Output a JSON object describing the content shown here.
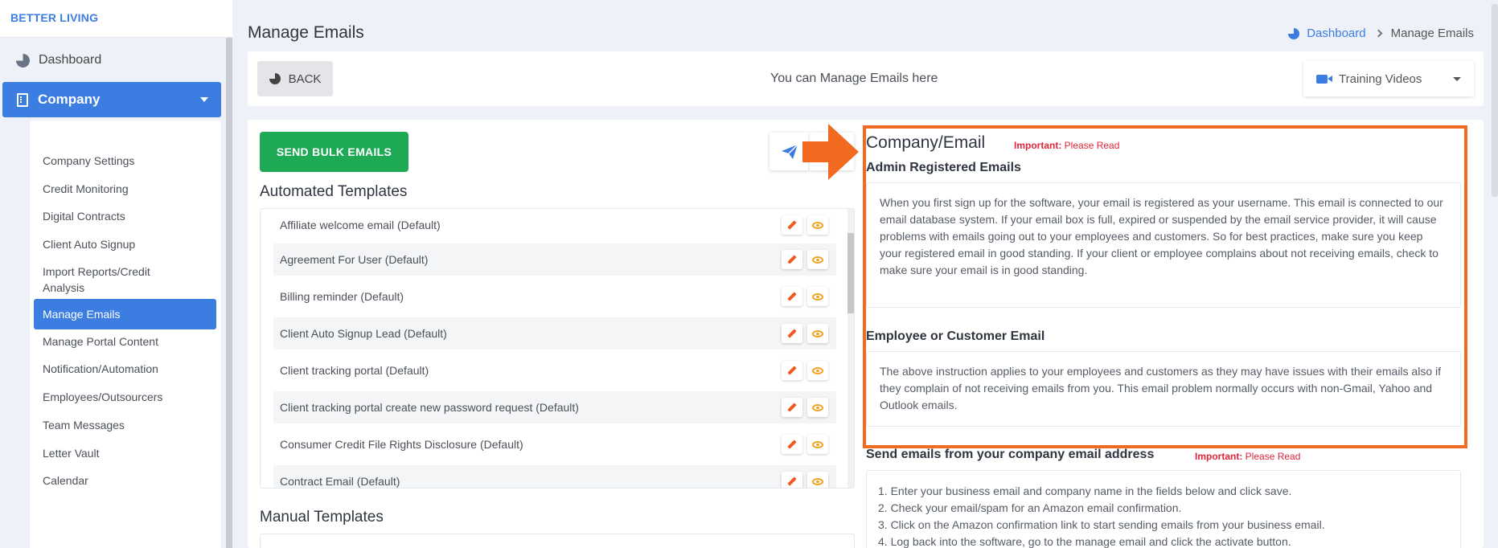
{
  "sidebar": {
    "brand": "BETTER LIVING",
    "dashboard": "Dashboard",
    "company": "Company",
    "items": [
      {
        "label": "Company Settings"
      },
      {
        "label": "Credit Monitoring"
      },
      {
        "label": "Digital Contracts"
      },
      {
        "label": "Client Auto Signup"
      },
      {
        "label": "Import Reports/Credit\nAnalysis"
      },
      {
        "label": "Manage Emails"
      },
      {
        "label": "Manage Portal Content"
      },
      {
        "label": "Notification/Automation"
      },
      {
        "label": "Employees/Outsourcers"
      },
      {
        "label": "Team Messages"
      },
      {
        "label": "Letter Vault"
      },
      {
        "label": "Calendar"
      }
    ]
  },
  "header": {
    "title": "Manage Emails",
    "breadcrumb": {
      "home": "Dashboard",
      "current": "Manage Emails"
    }
  },
  "topbar": {
    "back_label": "BACK",
    "message": "You can Manage Emails here",
    "training_label": "Training Videos"
  },
  "main": {
    "send_bulk_label": "SEND BULK EMAILS",
    "automated_heading": "Automated Templates",
    "manual_heading": "Manual Templates",
    "templates": [
      {
        "name": "Affiliate welcome email (Default)"
      },
      {
        "name": "Agreement For User (Default)"
      },
      {
        "name": "Billing reminder (Default)"
      },
      {
        "name": "Client Auto Signup Lead (Default)"
      },
      {
        "name": "Client tracking portal (Default)"
      },
      {
        "name": "Client tracking portal create new password request (Default)"
      },
      {
        "name": "Consumer Credit File Rights Disclosure (Default)"
      },
      {
        "name": "Contract Email (Default)"
      }
    ]
  },
  "info": {
    "title": "Company/Email",
    "important_label": "Important:",
    "important_text": "Please Read",
    "admin_heading": "Admin Registered Emails",
    "admin_text": "When you first sign up for the software, your email is registered as your username. This email is connected to our email database system. If your email box is full, expired or suspended by the email service provider, it will cause problems with emails going out to your employees and customers. So for best practices, make sure you keep your registered email in good standing. If your client or employee complains about not receiving emails, check to make sure your email is in good standing.",
    "employee_heading": "Employee or Customer Email",
    "employee_text": "The above instruction applies to your employees and customers as they may have issues with their emails also if they complain of not receiving emails from you. This email problem normally occurs with non-Gmail, Yahoo and Outlook emails.",
    "send_heading": "Send emails from your company email address",
    "steps": [
      "1. Enter your business email and company name in the fields below and click save.",
      "2. Check your email/spam for an Amazon email confirmation.",
      "3. Click on the Amazon confirmation link to start sending emails from your business email.",
      "4. Log back into the software, go to the manage email and click the activate button."
    ]
  },
  "colors": {
    "primary": "#3b7de0",
    "success": "#1eaa55",
    "highlight": "#f26a1f",
    "important": "#e0243a"
  }
}
